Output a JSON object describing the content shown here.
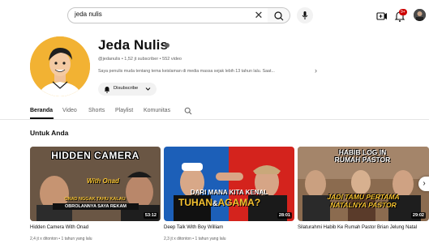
{
  "search": {
    "value": "jeda nulis",
    "clear_glyph": "✕"
  },
  "notifications": {
    "badge": "9+"
  },
  "channel": {
    "name": "Jeda Nulis",
    "meta": "@jedanulis • 1,52 jt subscriber • 552 video",
    "description": "Saya penulis muda tentang tema keislaman di media massa sejak lebih 13 tahun lalu. Saat...",
    "subscribe_label": "Disubscribe"
  },
  "tabs": [
    {
      "label": "Beranda"
    },
    {
      "label": "Video"
    },
    {
      "label": "Shorts"
    },
    {
      "label": "Playlist"
    },
    {
      "label": "Komunitas"
    }
  ],
  "section_title": "Untuk Anda",
  "videos": [
    {
      "title": "Hidden Camera With Onad",
      "meta": "2,4 jt x ditonton • 1 tahun yang lalu",
      "duration": "53:12",
      "thumb_top_text": "HIDDEN CAMERA",
      "thumb_script_text": "With Onad",
      "thumb_bottom_text_1": "ONAD NGGAK TAHU KALAU",
      "thumb_bottom_text_2": "OBROLANNYA SAYA REKAM"
    },
    {
      "title": "Deep Talk With Boy William",
      "meta": "2,3 jt x ditonton • 1 tahun yang lalu",
      "duration": "28:01",
      "thumb_text_1": "DARI MANA KITA KENAL",
      "thumb_text_2": "TUHAN",
      "thumb_text_3": "&",
      "thumb_text_4": "AGAMA?"
    },
    {
      "title": "Silaturahmi Habib Ke Rumah Pastor Brian Jelung Natal",
      "meta": "",
      "duration": "29:02",
      "thumb_top_text_1": "HABIB LOG IN",
      "thumb_top_text_2": "RUMAH PASTOR",
      "thumb_bottom_text_1": "JADI TAMU PERTAMA",
      "thumb_bottom_text_2": "NATALNYA PASTOR"
    }
  ],
  "colors": {
    "brand_red": "#cc0000",
    "text": "#0f0f0f",
    "muted": "#606060"
  },
  "icons": [
    "search-icon",
    "clear-icon",
    "mic-icon",
    "create-icon",
    "bell-icon",
    "bell-small-icon",
    "chevron-down-icon",
    "chevron-right-icon",
    "tab-search-icon",
    "verified-icon"
  ]
}
